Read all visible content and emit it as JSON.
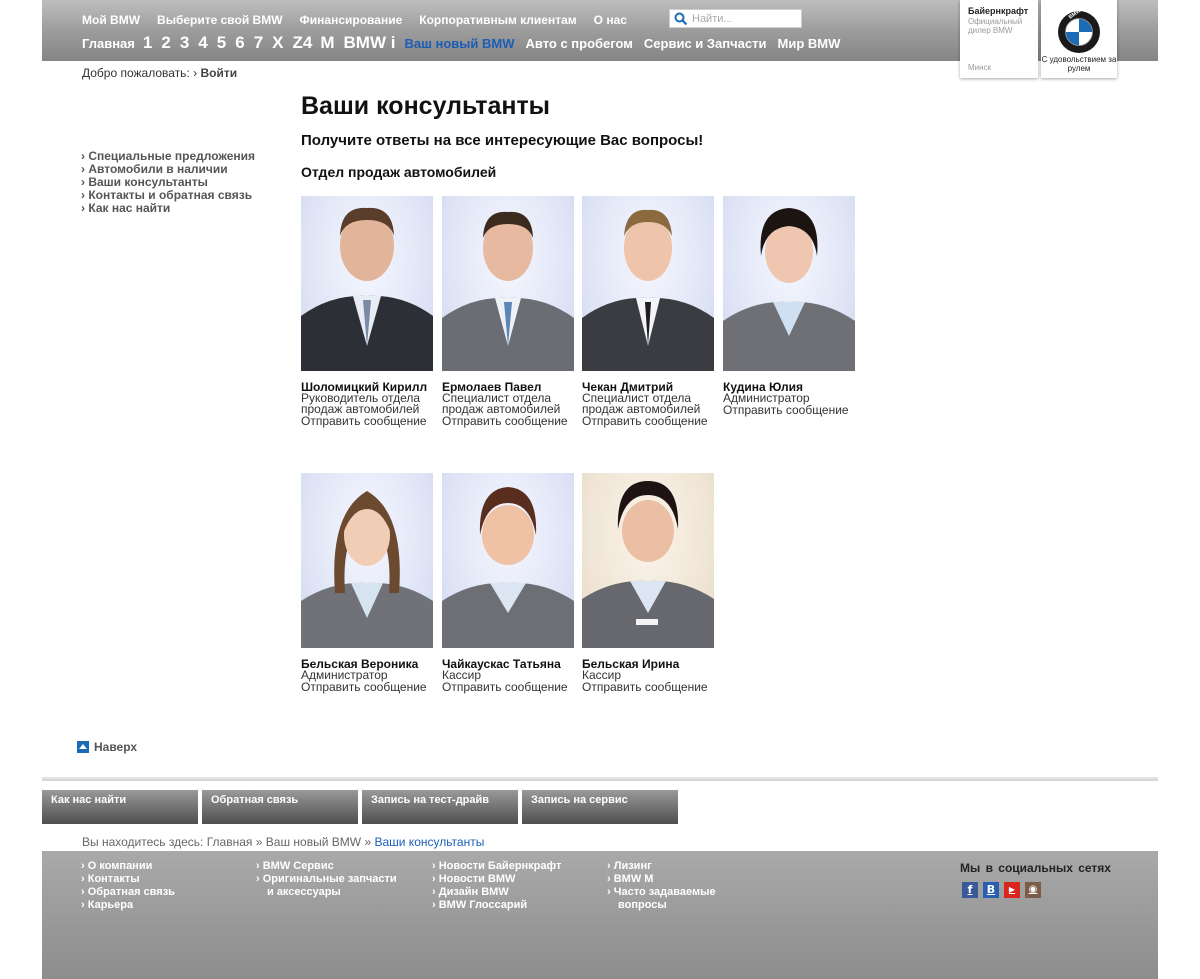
{
  "header": {
    "nav_top": [
      "Мой BMW",
      "Выберите свой BMW",
      "Финансирование",
      "Корпоративным клиентам",
      "О нас"
    ],
    "search_placeholder": "Найти...",
    "nav_main": {
      "home": "Главная",
      "series": [
        "1",
        "2",
        "3",
        "4",
        "5",
        "6",
        "7",
        "X",
        "Z4",
        "M",
        "BMW i"
      ],
      "links": [
        "Ваш новый BMW",
        "Авто с пробегом",
        "Сервис и Запчасти",
        "Мир BMW"
      ],
      "active_link": "Ваш новый BMW"
    },
    "dealer": {
      "name": "Байернкрафт",
      "subtitle": "Официальный дилер BMW",
      "city": "Минск"
    },
    "brand": {
      "slogan": "С удовольствием за рулем",
      "logo_letters": "BMW"
    },
    "welcome_text": "Добро пожаловать:",
    "login_link": "Войти"
  },
  "sidebar": {
    "items": [
      "Специальные предложения",
      "Автомобили в наличии",
      "Ваши консультанты",
      "Контакты и обратная связь",
      "Как нас найти"
    ]
  },
  "main": {
    "title": "Ваши консультанты",
    "subtitle": "Получите ответы на все интересующие Вас вопросы!",
    "section_title": "Отдел продаж автомобилей",
    "message_link": "Отправить сообщение",
    "staff": [
      {
        "name": "Шоломицкий Кирилл",
        "role": "Руководитель отдела продаж автомобилей"
      },
      {
        "name": "Ермолаев Павел",
        "role": "Специалист отдела продаж автомобилей"
      },
      {
        "name": "Чекан Дмитрий",
        "role": "Специалист отдела продаж автомобилей"
      },
      {
        "name": "Кудина Юлия",
        "role": "Администратор"
      },
      {
        "name": "Бельская Вероника",
        "role": "Администратор"
      },
      {
        "name": "Чайкаускас Татьяна",
        "role": "Кассир"
      },
      {
        "name": "Бельская Ирина",
        "role": "Кассир"
      }
    ],
    "back_to_top": "Наверх"
  },
  "footer": {
    "buttons": [
      "Как нас найти",
      "Обратная связь",
      "Запись на тест-драйв",
      "Запись на сервис"
    ],
    "breadcrumb": {
      "prefix": "Вы находитесь здесь:",
      "items": [
        "Главная",
        "Ваш новый BMW"
      ],
      "current": "Ваши консультанты",
      "separator": "»"
    },
    "columns": [
      [
        "О компании",
        "Контакты",
        "Обратная связь",
        "Карьера"
      ],
      [
        "BMW Сервис",
        "Оригинальные запчасти",
        "и аксессуары"
      ],
      [
        "Новости Байернкрафт",
        "Новости BMW",
        "Дизайн BMW",
        "BMW Глоссарий"
      ],
      [
        "Лизинг",
        "BMW M",
        "Часто задаваемые",
        "вопросы"
      ]
    ],
    "social_title": "Мы в социальных сетях",
    "social": [
      {
        "name": "facebook",
        "glyph": "f",
        "color": "#3b5998"
      },
      {
        "name": "vkontakte",
        "glyph": "B",
        "color": "#2a5fb0"
      },
      {
        "name": "youtube",
        "glyph": "▶",
        "color": "#d9261c"
      },
      {
        "name": "instagram",
        "glyph": "◉",
        "color": "#7a5c48"
      }
    ]
  },
  "colors": {
    "accent": "#1c5db6",
    "header_gray": "#9a9a9a",
    "footer_gray": "#a0a0a0"
  }
}
